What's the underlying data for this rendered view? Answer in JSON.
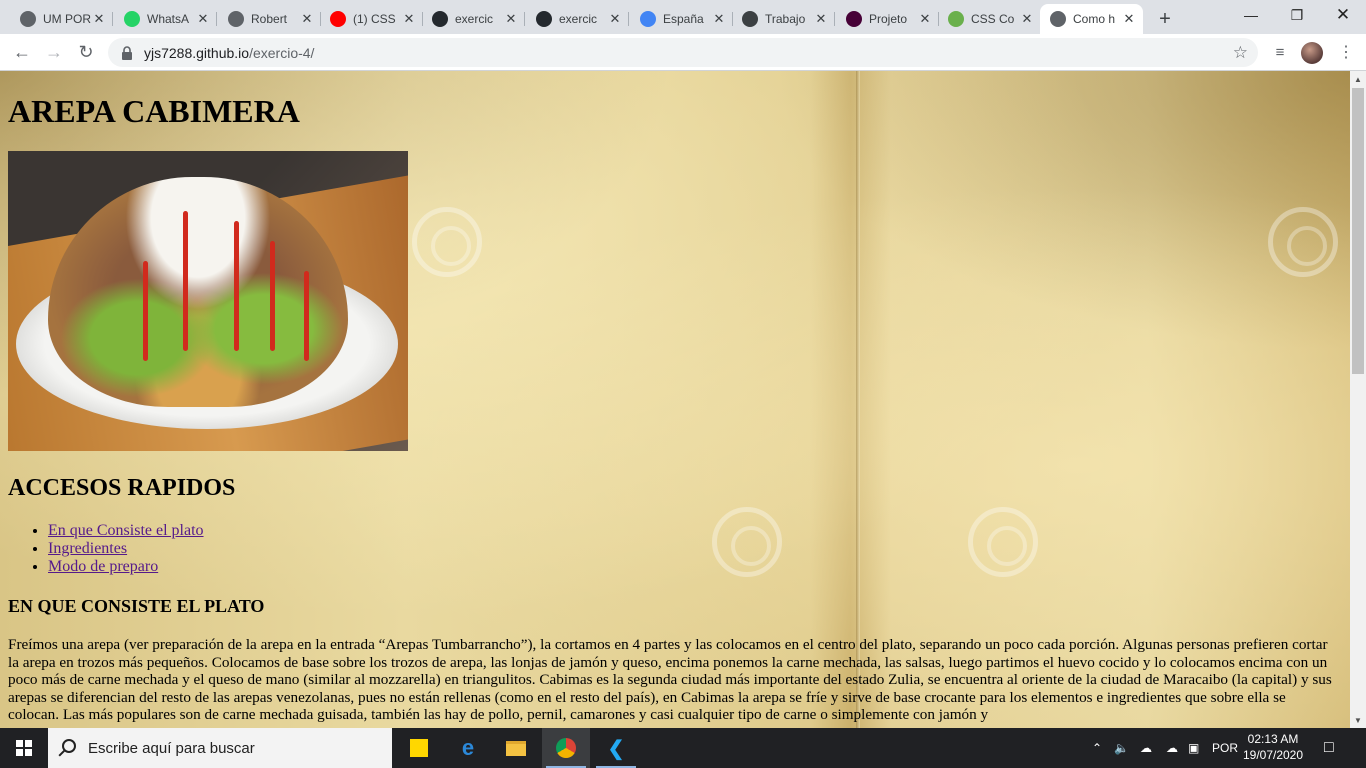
{
  "browser": {
    "tabs": [
      {
        "title": "UM POR",
        "icon": "globe-icon",
        "color": "#5f6368"
      },
      {
        "title": "WhatsA",
        "icon": "whatsapp-icon",
        "color": "#25d366"
      },
      {
        "title": "Robert",
        "icon": "globe-icon",
        "color": "#5f6368"
      },
      {
        "title": "(1) CSS",
        "icon": "youtube-icon",
        "color": "#ff0000"
      },
      {
        "title": "exercic",
        "icon": "github-icon",
        "color": "#24292e"
      },
      {
        "title": "exercic",
        "icon": "github-icon",
        "color": "#24292e"
      },
      {
        "title": "España",
        "icon": "puzzle-icon",
        "color": "#4285f4"
      },
      {
        "title": "Trabajo",
        "icon": "classroom-icon",
        "color": "#3c4043"
      },
      {
        "title": "Projeto",
        "icon": "xd-icon",
        "color": "#470137"
      },
      {
        "title": "CSS Co",
        "icon": "css-icon",
        "color": "#6ab04c"
      },
      {
        "title": "Como h",
        "icon": "globe-icon",
        "color": "#5f6368",
        "active": true
      }
    ],
    "address": {
      "host": "yjs7288.github.io",
      "path": "/exercio-4/"
    }
  },
  "page": {
    "title": "AREPA CABIMERA",
    "quick_access_heading": "ACCESOS RAPIDOS",
    "links": [
      "En que Consiste el plato",
      "Ingredientes",
      "Modo de preparo"
    ],
    "section_heading": "EN QUE CONSISTE EL PLATO",
    "paragraph": "Freímos una arepa (ver preparación de la arepa en la entrada “Arepas Tumbarrancho”), la cortamos en 4 partes y las colocamos en el centro del plato, separando un poco cada porción. Algunas personas prefieren cortar la arepa en trozos más pequeños. Colocamos de base sobre los trozos de arepa, las lonjas de jamón y queso, encima ponemos la carne mechada, las salsas, luego partimos el huevo cocido y lo colocamos encima con un poco más de carne mechada y el queso de mano (similar al mozzarella) en triangulitos. Cabimas es la segunda ciudad más importante del estado Zulia, se encuentra al oriente de la ciudad de Maracaibo (la capital) y sus arepas se diferencian del resto de las arepas venezolanas, pues no están rellenas (como en el resto del país), en Cabimas la arepa se fríe y sirve de base crocante para los elementos e ingredientes que sobre ella se colocan. Las más populares son de carne mechada guisada, también las hay de pollo, pernil, camarones y casi cualquier tipo de carne o simplemente con jamón y"
  },
  "taskbar": {
    "search_placeholder": "Escribe aquí para buscar",
    "language": "POR",
    "time": "02:13 AM",
    "date": "19/07/2020"
  }
}
